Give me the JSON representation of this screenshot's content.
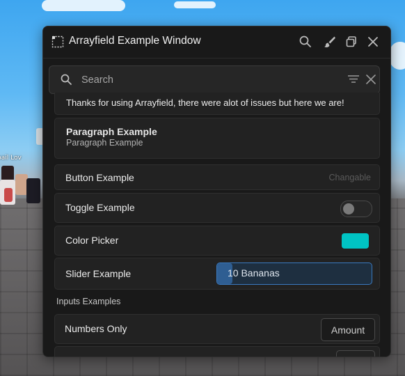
{
  "window": {
    "title": "Arrayfield Example Window"
  },
  "search": {
    "placeholder": "Search"
  },
  "items": {
    "label_text": "Thanks for using Arrayfield, there were alot of issues but here we are!",
    "paragraph": {
      "title": "Paragraph Example",
      "body": "Paragraph Example"
    },
    "button": {
      "label": "Button Example",
      "hint": "Changable"
    },
    "toggle": {
      "label": "Toggle Example",
      "on": false
    },
    "color_picker": {
      "label": "Color Picker",
      "color": "#00c4c4"
    },
    "slider": {
      "label": "Slider Example",
      "value_text": "10 Bananas",
      "fraction": 0.1
    },
    "inputs_section": {
      "title": "Inputs Examples"
    },
    "numbers_only": {
      "label": "Numbers Only",
      "placeholder": "Amount"
    }
  },
  "colors": {
    "accent_blue": "#3a7ac0",
    "window_bg": "#191919",
    "card_bg": "#222222"
  },
  "icons": {
    "title": "grid-icon",
    "search": "search-icon",
    "theme": "brush-icon",
    "minimize": "windows-icon",
    "close": "close-icon",
    "filter": "filter-icon",
    "clear": "x-icon"
  }
}
